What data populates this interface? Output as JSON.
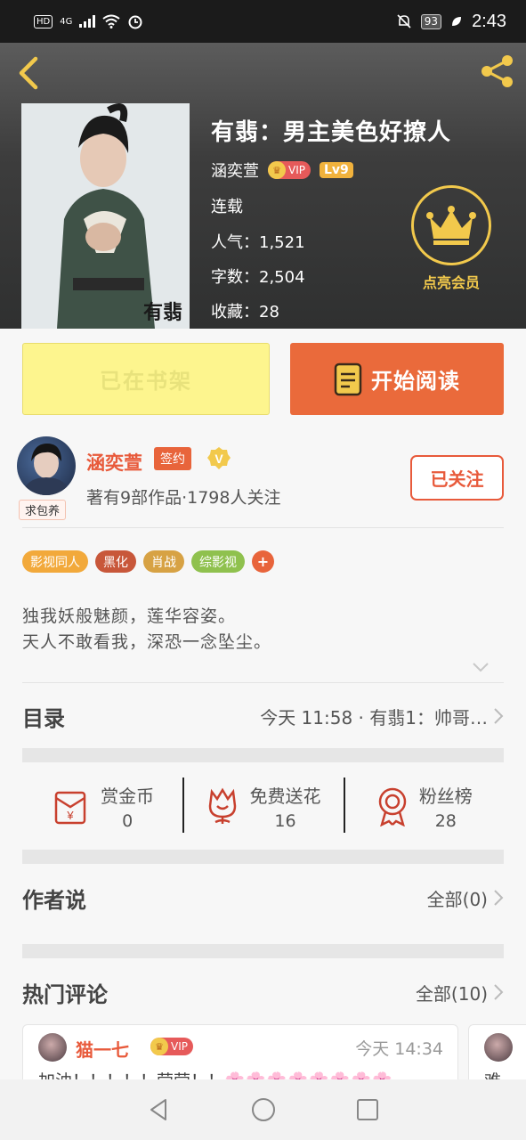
{
  "status_bar": {
    "left_chips": [
      "HD",
      "4G"
    ],
    "battery": "93",
    "time": "2:43"
  },
  "book": {
    "title": "有翡：男主美色好撩人",
    "author": "涵奕萱",
    "vip_label": "VIP",
    "level": "Lv9",
    "status": "连载",
    "popularity": "人气：1,521",
    "word_count": "字数：2,504",
    "favorites": "收藏：28",
    "cover_text": "有翡"
  },
  "vip_member": {
    "label": "点亮会员"
  },
  "actions": {
    "shelf_label": "已在书架",
    "read_label": "开始阅读"
  },
  "author_card": {
    "name": "涵奕萱",
    "sign_label": "签约",
    "stats": "著有9部作品·1798人关注",
    "follow_label": "已关注",
    "support_label": "求包养"
  },
  "tags": [
    {
      "label": "影视同人",
      "color": "#f2a93b"
    },
    {
      "label": "黑化",
      "color": "#c8573a"
    },
    {
      "label": "肖战",
      "color": "#d7a244"
    },
    {
      "label": "综影视",
      "color": "#8fc14e"
    }
  ],
  "synopsis": {
    "line1": "独我妖般魅颜，莲华容姿。",
    "line2": "天人不敢看我，深恐一念坠尘。"
  },
  "catalog": {
    "title": "目录",
    "latest": "今天 11:58 · 有翡1：帅哥…"
  },
  "stats": {
    "reward_label": "赏金币",
    "reward_value": "0",
    "flower_label": "免费送花",
    "flower_value": "16",
    "fans_label": "粉丝榜",
    "fans_value": "28"
  },
  "author_say": {
    "title": "作者说",
    "all": "全部(0)"
  },
  "hot_comments": {
    "title": "热门评论",
    "all": "全部(10)",
    "first": {
      "user": "猫一七",
      "vip": "VIP",
      "time": "今天 14:34",
      "text": "加油！！！！！莹莹！！🌸🌸🌸🌸🌸🌸🌸🌸"
    },
    "second_preview": "难"
  }
}
